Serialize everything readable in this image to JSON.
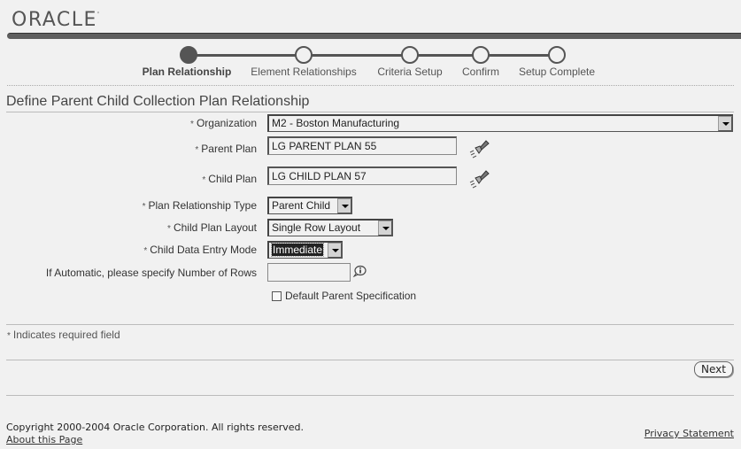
{
  "header": {
    "logo_text": "ORACLE",
    "logo_tm": "'"
  },
  "train": {
    "steps": [
      {
        "label": "Plan Relationship",
        "active": true
      },
      {
        "label": "Element Relationships",
        "active": false
      },
      {
        "label": "Criteria Setup",
        "active": false
      },
      {
        "label": "Confirm",
        "active": false
      },
      {
        "label": "Setup Complete",
        "active": false
      }
    ]
  },
  "page": {
    "title": "Define Parent Child Collection Plan Relationship"
  },
  "form": {
    "required_marker": "*",
    "organization": {
      "label": "Organization",
      "value": "M2 - Boston Manufacturing"
    },
    "parent_plan": {
      "label": "Parent Plan",
      "value": "LG PARENT PLAN 55"
    },
    "child_plan": {
      "label": "Child Plan",
      "value": "LG CHILD PLAN 57"
    },
    "plan_relationship_type": {
      "label": "Plan Relationship Type",
      "value": "Parent Child"
    },
    "child_plan_layout": {
      "label": "Child Plan Layout",
      "value": "Single Row Layout"
    },
    "child_data_entry_mode": {
      "label": "Child Data Entry Mode",
      "value": "Immediate"
    },
    "number_of_rows": {
      "label": "If Automatic, please specify Number of Rows",
      "value": ""
    },
    "default_parent_spec": {
      "label": "Default Parent Specification",
      "checked": false
    }
  },
  "notes": {
    "required_field": "Indicates required field"
  },
  "actions": {
    "next_label": "Next"
  },
  "footer": {
    "copyright": "Copyright 2000-2004 Oracle Corporation. All rights reserved.",
    "about_link": "About this Page",
    "privacy_link": "Privacy Statement"
  },
  "colors": {
    "background": "#f1f1f1",
    "brand_bar": "#5e5e5e",
    "train_active": "#555555"
  }
}
